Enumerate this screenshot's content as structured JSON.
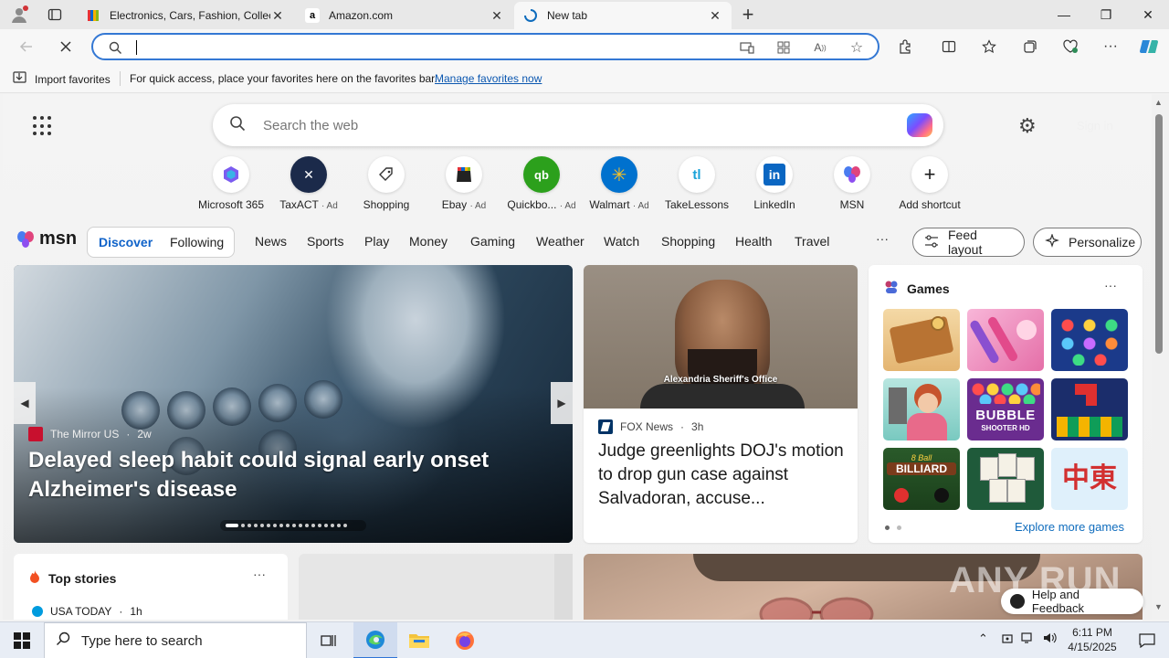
{
  "browser": {
    "tabs": [
      {
        "title": "Electronics, Cars, Fashion, Collectibles & More | eBay",
        "active": false
      },
      {
        "title": "Amazon.com",
        "active": false
      },
      {
        "title": "New tab",
        "active": true
      }
    ],
    "new_tab_symbol": "+",
    "window_controls": {
      "minimize": "—",
      "restore": "❐",
      "close": "✕"
    },
    "address_bar": {
      "value": "",
      "placeholder": ""
    },
    "favorites_bar": {
      "import_label": "Import favorites",
      "message": "For quick access, place your favorites here on the favorites bar.",
      "link_label": "Manage favorites now"
    }
  },
  "newtab": {
    "search_placeholder": "Search the web",
    "sign_in": "Sign in",
    "quick_links": [
      {
        "label": "Microsoft 365",
        "ad": "",
        "icon": "m365-icon"
      },
      {
        "label": "TaxACT",
        "ad": "· Ad",
        "icon": "taxact-icon"
      },
      {
        "label": "Shopping",
        "ad": "",
        "icon": "tag-icon"
      },
      {
        "label": "Ebay",
        "ad": "· Ad",
        "icon": "ebay-icon"
      },
      {
        "label": "Quickbo...",
        "ad": "· Ad",
        "icon": "quickbooks-icon"
      },
      {
        "label": "Walmart",
        "ad": "· Ad",
        "icon": "walmart-icon"
      },
      {
        "label": "TakeLessons",
        "ad": "",
        "icon": "takelessons-icon"
      },
      {
        "label": "LinkedIn",
        "ad": "",
        "icon": "linkedin-icon"
      },
      {
        "label": "MSN",
        "ad": "",
        "icon": "msn-icon"
      },
      {
        "label": "Add shortcut",
        "ad": "",
        "icon": "plus-icon"
      }
    ],
    "msn_label": "msn",
    "toggle": {
      "discover": "Discover",
      "following": "Following"
    },
    "nav": [
      "News",
      "Sports",
      "Play",
      "Money",
      "Gaming",
      "Weather",
      "Watch",
      "Shopping",
      "Health",
      "Travel"
    ],
    "more": "···",
    "feed_layout": "Feed layout",
    "personalize": "Personalize",
    "hero": {
      "source": "The Mirror US",
      "age": "2w",
      "title": "Delayed sleep habit could signal early onset Alzheimer's disease"
    },
    "news_card": {
      "caption": "Alexandria Sheriff's Office",
      "source": "FOX News",
      "age": "3h",
      "title": "Judge greenlights DOJ's motion to drop gun case against Salvadoran, accuse..."
    },
    "games": {
      "title": "Games",
      "more": "···",
      "explore": "Explore more games",
      "tile_texts": {
        "bubble": "BUBBLE",
        "bubble_sub": "SHOOTER HD",
        "billiard_top": "8 Ball",
        "billiard": "BILLIARD",
        "mahjong": "中東"
      }
    },
    "top_stories": {
      "title": "Top stories",
      "more": "···",
      "source": "USA TODAY",
      "age": "1h"
    },
    "watermark": "ANY RUN",
    "help": "Help and Feedback"
  },
  "taskbar": {
    "search_placeholder": "Type here to search",
    "time": "6:11 PM",
    "date": "4/15/2025"
  }
}
